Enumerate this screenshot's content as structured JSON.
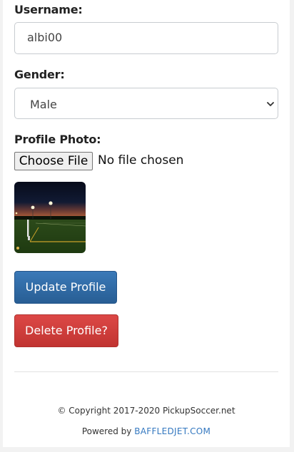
{
  "form": {
    "username_label": "Username:",
    "username_value": "albi00",
    "gender_label": "Gender:",
    "gender_selected": "Male",
    "photo_label": "Profile Photo:",
    "choose_file_label": "Choose File",
    "file_status": "No file chosen",
    "update_button": "Update Profile",
    "delete_button": "Delete Profile?"
  },
  "footer": {
    "copyright": "© Copyright 2017-2020 PickupSoccer.net",
    "powered_by": "Powered by",
    "powered_link": "BAFFLEDJET.COM"
  },
  "colors": {
    "update_button": "#2f6ca6",
    "delete_button": "#d43f3c",
    "link": "#3478c0"
  },
  "icons": {
    "select_arrow": "chevron-down-icon"
  }
}
